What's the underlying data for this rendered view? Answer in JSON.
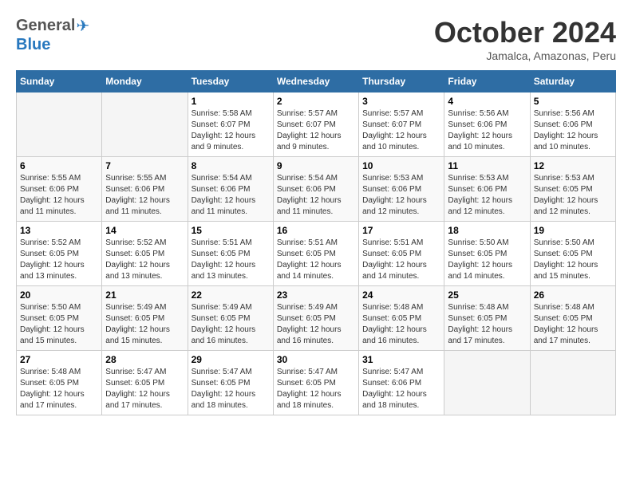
{
  "header": {
    "logo_general": "General",
    "logo_blue": "Blue",
    "month_title": "October 2024",
    "subtitle": "Jamalca, Amazonas, Peru"
  },
  "days_of_week": [
    "Sunday",
    "Monday",
    "Tuesday",
    "Wednesday",
    "Thursday",
    "Friday",
    "Saturday"
  ],
  "weeks": [
    [
      {
        "day": "",
        "info": ""
      },
      {
        "day": "",
        "info": ""
      },
      {
        "day": "1",
        "info": "Sunrise: 5:58 AM\nSunset: 6:07 PM\nDaylight: 12 hours and 9 minutes."
      },
      {
        "day": "2",
        "info": "Sunrise: 5:57 AM\nSunset: 6:07 PM\nDaylight: 12 hours and 9 minutes."
      },
      {
        "day": "3",
        "info": "Sunrise: 5:57 AM\nSunset: 6:07 PM\nDaylight: 12 hours and 10 minutes."
      },
      {
        "day": "4",
        "info": "Sunrise: 5:56 AM\nSunset: 6:06 PM\nDaylight: 12 hours and 10 minutes."
      },
      {
        "day": "5",
        "info": "Sunrise: 5:56 AM\nSunset: 6:06 PM\nDaylight: 12 hours and 10 minutes."
      }
    ],
    [
      {
        "day": "6",
        "info": "Sunrise: 5:55 AM\nSunset: 6:06 PM\nDaylight: 12 hours and 11 minutes."
      },
      {
        "day": "7",
        "info": "Sunrise: 5:55 AM\nSunset: 6:06 PM\nDaylight: 12 hours and 11 minutes."
      },
      {
        "day": "8",
        "info": "Sunrise: 5:54 AM\nSunset: 6:06 PM\nDaylight: 12 hours and 11 minutes."
      },
      {
        "day": "9",
        "info": "Sunrise: 5:54 AM\nSunset: 6:06 PM\nDaylight: 12 hours and 11 minutes."
      },
      {
        "day": "10",
        "info": "Sunrise: 5:53 AM\nSunset: 6:06 PM\nDaylight: 12 hours and 12 minutes."
      },
      {
        "day": "11",
        "info": "Sunrise: 5:53 AM\nSunset: 6:06 PM\nDaylight: 12 hours and 12 minutes."
      },
      {
        "day": "12",
        "info": "Sunrise: 5:53 AM\nSunset: 6:05 PM\nDaylight: 12 hours and 12 minutes."
      }
    ],
    [
      {
        "day": "13",
        "info": "Sunrise: 5:52 AM\nSunset: 6:05 PM\nDaylight: 12 hours and 13 minutes."
      },
      {
        "day": "14",
        "info": "Sunrise: 5:52 AM\nSunset: 6:05 PM\nDaylight: 12 hours and 13 minutes."
      },
      {
        "day": "15",
        "info": "Sunrise: 5:51 AM\nSunset: 6:05 PM\nDaylight: 12 hours and 13 minutes."
      },
      {
        "day": "16",
        "info": "Sunrise: 5:51 AM\nSunset: 6:05 PM\nDaylight: 12 hours and 14 minutes."
      },
      {
        "day": "17",
        "info": "Sunrise: 5:51 AM\nSunset: 6:05 PM\nDaylight: 12 hours and 14 minutes."
      },
      {
        "day": "18",
        "info": "Sunrise: 5:50 AM\nSunset: 6:05 PM\nDaylight: 12 hours and 14 minutes."
      },
      {
        "day": "19",
        "info": "Sunrise: 5:50 AM\nSunset: 6:05 PM\nDaylight: 12 hours and 15 minutes."
      }
    ],
    [
      {
        "day": "20",
        "info": "Sunrise: 5:50 AM\nSunset: 6:05 PM\nDaylight: 12 hours and 15 minutes."
      },
      {
        "day": "21",
        "info": "Sunrise: 5:49 AM\nSunset: 6:05 PM\nDaylight: 12 hours and 15 minutes."
      },
      {
        "day": "22",
        "info": "Sunrise: 5:49 AM\nSunset: 6:05 PM\nDaylight: 12 hours and 16 minutes."
      },
      {
        "day": "23",
        "info": "Sunrise: 5:49 AM\nSunset: 6:05 PM\nDaylight: 12 hours and 16 minutes."
      },
      {
        "day": "24",
        "info": "Sunrise: 5:48 AM\nSunset: 6:05 PM\nDaylight: 12 hours and 16 minutes."
      },
      {
        "day": "25",
        "info": "Sunrise: 5:48 AM\nSunset: 6:05 PM\nDaylight: 12 hours and 17 minutes."
      },
      {
        "day": "26",
        "info": "Sunrise: 5:48 AM\nSunset: 6:05 PM\nDaylight: 12 hours and 17 minutes."
      }
    ],
    [
      {
        "day": "27",
        "info": "Sunrise: 5:48 AM\nSunset: 6:05 PM\nDaylight: 12 hours and 17 minutes."
      },
      {
        "day": "28",
        "info": "Sunrise: 5:47 AM\nSunset: 6:05 PM\nDaylight: 12 hours and 17 minutes."
      },
      {
        "day": "29",
        "info": "Sunrise: 5:47 AM\nSunset: 6:05 PM\nDaylight: 12 hours and 18 minutes."
      },
      {
        "day": "30",
        "info": "Sunrise: 5:47 AM\nSunset: 6:05 PM\nDaylight: 12 hours and 18 minutes."
      },
      {
        "day": "31",
        "info": "Sunrise: 5:47 AM\nSunset: 6:06 PM\nDaylight: 12 hours and 18 minutes."
      },
      {
        "day": "",
        "info": ""
      },
      {
        "day": "",
        "info": ""
      }
    ]
  ]
}
